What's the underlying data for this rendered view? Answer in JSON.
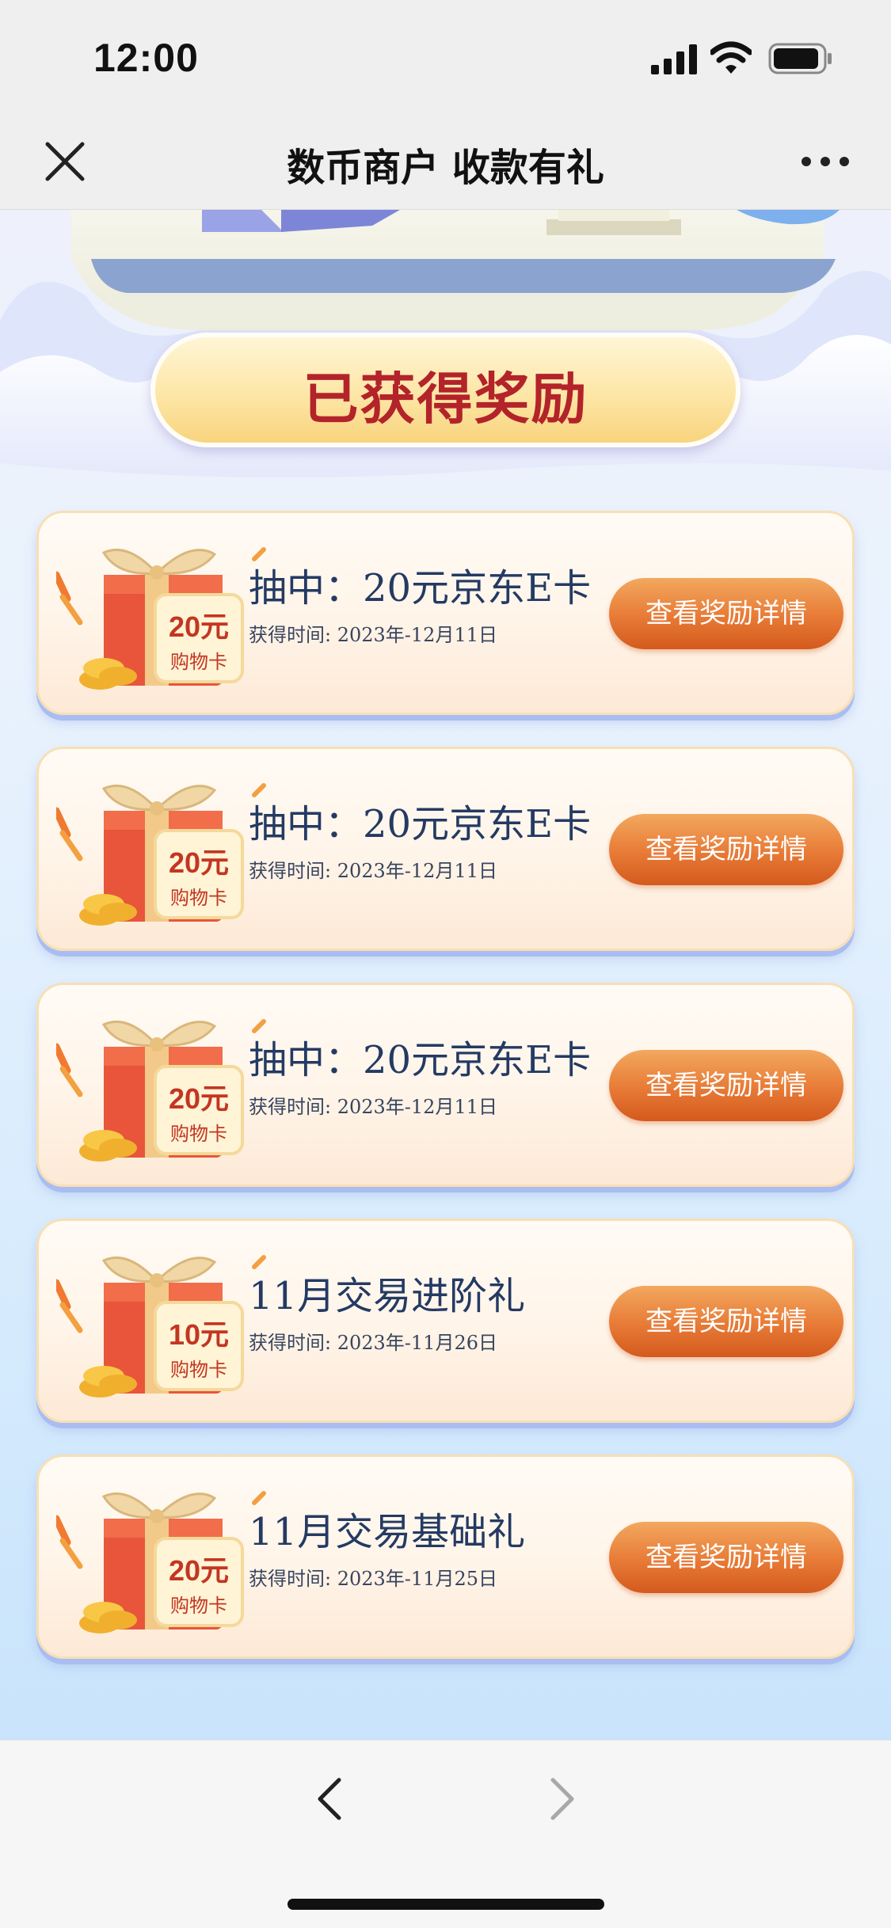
{
  "status_bar": {
    "time": "12:00"
  },
  "nav": {
    "title": "数币商户 收款有礼"
  },
  "banner": {
    "label": "已获得奖励"
  },
  "rewards": [
    {
      "title": "抽中：20元京东E卡",
      "time": "获得时间: 2023年-12月11日",
      "gift_amount": "20元",
      "gift_label": "购物卡",
      "button_label": "查看奖励详情"
    },
    {
      "title": "抽中：20元京东E卡",
      "time": "获得时间: 2023年-12月11日",
      "gift_amount": "20元",
      "gift_label": "购物卡",
      "button_label": "查看奖励详情"
    },
    {
      "title": "抽中：20元京东E卡",
      "time": "获得时间: 2023年-12月11日",
      "gift_amount": "20元",
      "gift_label": "购物卡",
      "button_label": "查看奖励详情"
    },
    {
      "title": "11月交易进阶礼",
      "time": "获得时间: 2023年-11月26日",
      "gift_amount": "10元",
      "gift_label": "购物卡",
      "button_label": "查看奖励详情"
    },
    {
      "title": "11月交易基础礼",
      "time": "获得时间: 2023年-11月25日",
      "gift_amount": "20元",
      "gift_label": "购物卡",
      "button_label": "查看奖励详情"
    }
  ],
  "colors": {
    "title_text": "#243a63",
    "banner_text": "#b3232a",
    "button_orange": "#e77a36",
    "gift_red": "#e8553a"
  }
}
